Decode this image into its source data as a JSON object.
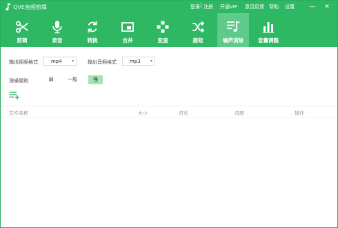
{
  "app": {
    "title": "QVE音频剪辑"
  },
  "topnav": {
    "login": "登录",
    "separator": "|",
    "register": "注册",
    "vip": "开通VIP",
    "feedback": "意见反馈",
    "help": "帮助",
    "settings": "设置"
  },
  "window_controls": {
    "minimize": "—",
    "close": "✕"
  },
  "toolbar": {
    "items": [
      {
        "label": "剪辑",
        "icon": "scissors-icon"
      },
      {
        "label": "录音",
        "icon": "microphone-icon"
      },
      {
        "label": "转换",
        "icon": "convert-arrows-icon"
      },
      {
        "label": "合并",
        "icon": "merge-icon"
      },
      {
        "label": "变速",
        "icon": "gamepad-icon"
      },
      {
        "label": "提取",
        "icon": "shuffle-icon"
      },
      {
        "label": "噪声消除",
        "icon": "music-list-icon",
        "active": true
      },
      {
        "label": "音量调整",
        "icon": "bar-chart-icon"
      }
    ]
  },
  "options": {
    "video_format_label": "输出视频格式",
    "video_format_value": "mp4",
    "audio_format_label": "输出音频格式",
    "audio_format_value": "mp3",
    "denoise_label": "消噪级别",
    "levels": [
      "弱",
      "一般",
      "强"
    ],
    "selected_level": "强"
  },
  "table": {
    "headers": {
      "name": "文件名称",
      "size": "大小",
      "duration": "时长",
      "progress": "进度",
      "action": "操作"
    },
    "rows": []
  },
  "colors": {
    "brand": "#2fb864",
    "active_tab": "#5ecb8a",
    "selected_level": "#a6e3b5"
  }
}
